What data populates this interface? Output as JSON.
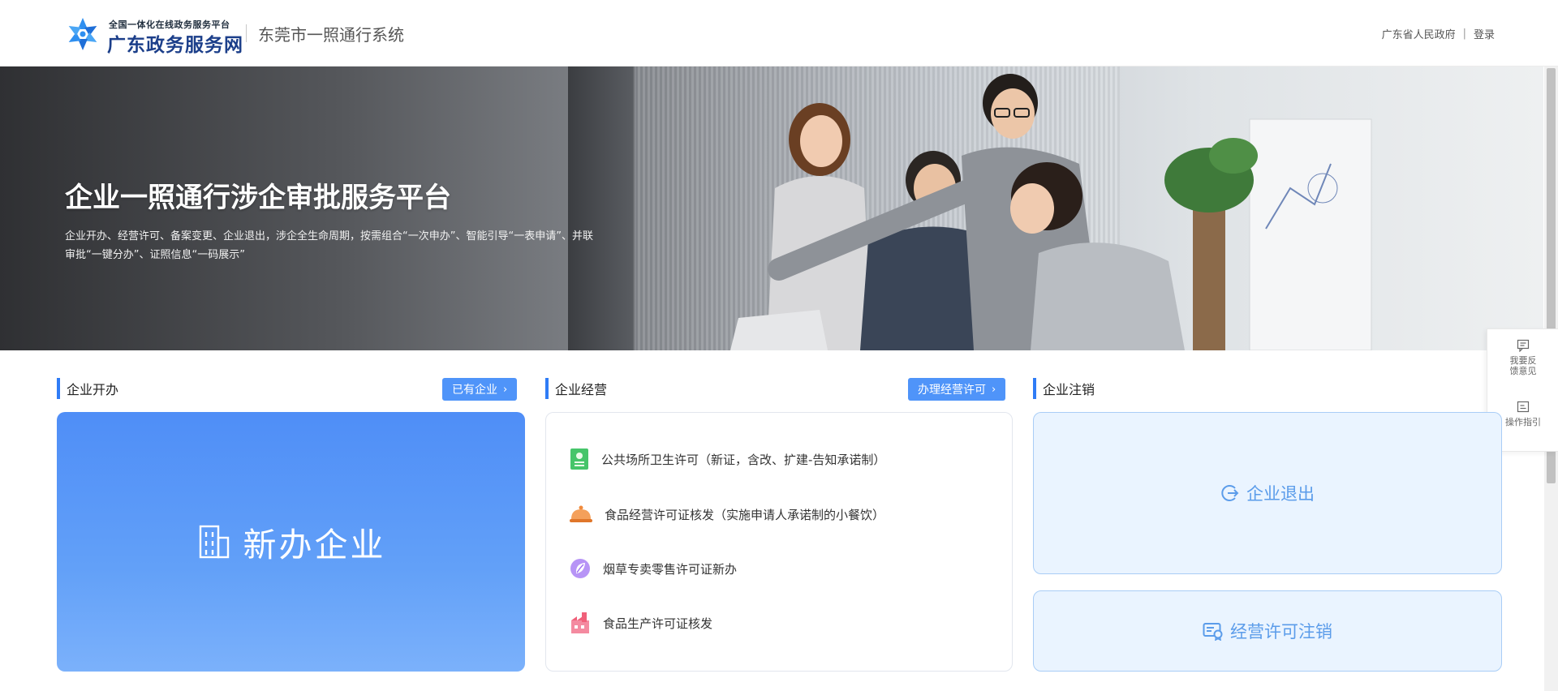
{
  "header": {
    "brand_sub": "全国一体化在线政务服务平台",
    "brand_main": "广东政务服务网",
    "system_name": "东莞市一照通行系统",
    "links": {
      "gov": "广东省人民政府",
      "separator": "|",
      "login": "登录"
    }
  },
  "banner": {
    "title": "企业一照通行涉企审批服务平台",
    "desc_line1": "企业开办、经营许可、备案变更、企业退出，涉企全生命周期，按需组合“一次申办”、智能引导“一表申请”、并联",
    "desc_line2": "审批“一键分办”、证照信息“一码展示”"
  },
  "side_tools": [
    {
      "label_line1": "我要反",
      "label_line2": "馈意见",
      "icon": "feedback-icon"
    },
    {
      "label_line1": "操作指引",
      "icon": "guide-icon"
    }
  ],
  "sections": {
    "open": {
      "title": "企业开办",
      "button": "已有企业",
      "card_label": "新办企业",
      "icon": "building-icon"
    },
    "operate": {
      "title": "企业经营",
      "button": "办理经营许可",
      "items": [
        {
          "label": "公共场所卫生许可（新证，含改、扩建-告知承诺制）",
          "icon": "certificate-icon",
          "color": "#46c56a"
        },
        {
          "label": "食品经营许可证核发（实施申请人承诺制的小餐饮）",
          "icon": "dish-cover-icon",
          "color": "#f08a3c"
        },
        {
          "label": "烟草专卖零售许可证新办",
          "icon": "tobacco-leaf-icon",
          "color": "#9b6cf2"
        },
        {
          "label": "食品生产许可证核发",
          "icon": "factory-icon",
          "color": "#f0607a"
        }
      ]
    },
    "cancel": {
      "title": "企业注销",
      "exit_label": "企业退出",
      "license_cancel_label": "经营许可注销",
      "accent": "#5b9cea"
    }
  },
  "colors": {
    "primary": "#2f7cf6",
    "button": "#4f94f9"
  }
}
